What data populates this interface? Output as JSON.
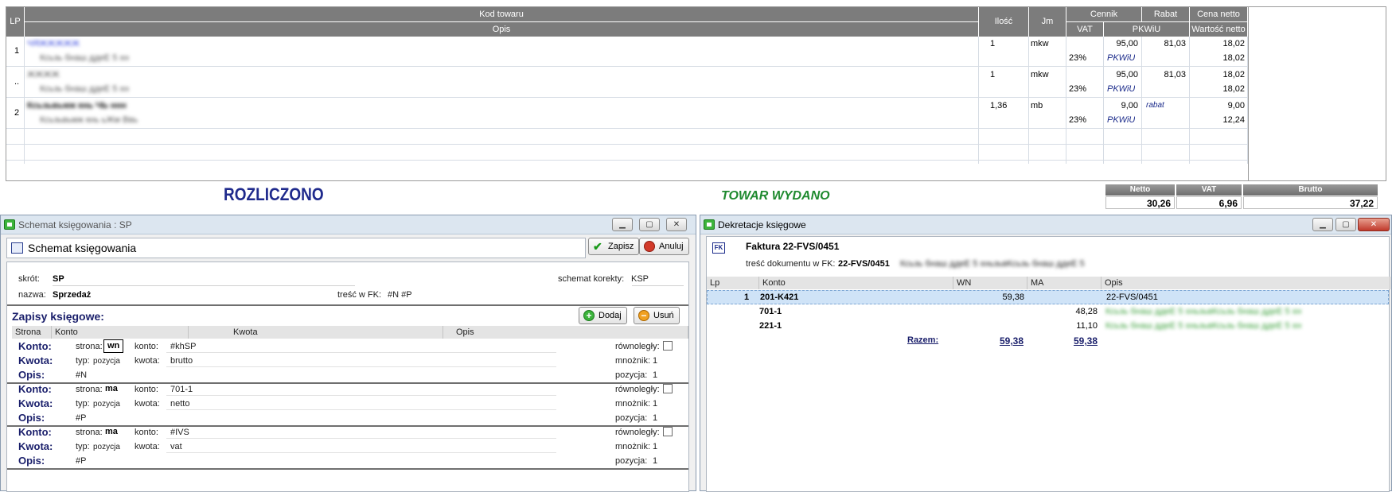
{
  "top_grid": {
    "headers": {
      "lp": "LP",
      "kod_towaru": "Kod towaru",
      "opis": "Opis",
      "ilosc": "Ilość",
      "jm": "Jm",
      "cennik": "Cennik",
      "rabat": "Rabat",
      "cena_netto": "Cena netto",
      "vat": "VAT",
      "pkwiu": "PKWiU",
      "wartosc_netto": "Wartość netto"
    },
    "rows": [
      {
        "lp": "1",
        "kod": "ЧЯЖЖЖЖЖ",
        "opis": "Ксьзь бнаш ддеЕ 5 хн",
        "ilosc": "1",
        "jm": "mkw",
        "cennik": "95,00",
        "rabat": "81,03",
        "cena_netto": "18,02",
        "vat": "23%",
        "pkwiu": "PKWiU",
        "wartosc_netto": "18,02"
      },
      {
        "lp": "..",
        "kod": "ЖЖЖЖ",
        "opis": "Ксьзь бнаш ддеЕ 5 хн",
        "ilosc": "1",
        "jm": "mkw",
        "cennik": "95,00",
        "rabat": "81,03",
        "cena_netto": "18,02",
        "vat": "23%",
        "pkwiu": "PKWiU",
        "wartosc_netto": "18,02"
      },
      {
        "lp": "2",
        "kod": "Ксьзьвьмж кнь ЧЬ ннн",
        "opis": "Ксьзьвьмж кнь ьЖм Ввь",
        "ilosc": "1,36",
        "jm": "mb",
        "cennik": "9,00",
        "rabat": "rabat",
        "cena_netto": "9,00",
        "vat": "23%",
        "pkwiu": "PKWiU",
        "wartosc_netto": "12,24"
      }
    ]
  },
  "stamps": {
    "rozliczono": "ROZLICZONO",
    "towar_wydano": "TOWAR WYDANO"
  },
  "totals": {
    "netto_label": "Netto",
    "netto": "30,26",
    "vat_label": "VAT",
    "vat": "6,96",
    "brutto_label": "Brutto",
    "brutto": "37,22"
  },
  "schemat_window": {
    "title": "Schemat księgowania : SP",
    "header": "Schemat księgowania",
    "save_label": "Zapisz",
    "cancel_label": "Anuluj",
    "skrot_label": "skrót:",
    "skrot": "SP",
    "nazwa_label": "nazwa:",
    "nazwa": "Sprzedaż",
    "korekty_label": "schemat korekty:",
    "korekty": "KSP",
    "tresc_label": "treść w FK:",
    "tresc": "#N #P",
    "zapisy_title": "Zapisy księgowe:",
    "add_label": "Dodaj",
    "remove_label": "Usuń",
    "cols": {
      "strona": "Strona",
      "konto": "Konto",
      "kwota": "Kwota",
      "opis": "Opis"
    },
    "entries": [
      {
        "konto_label": "Konto:",
        "kwota_label": "Kwota:",
        "opis_label": "Opis:",
        "strona_label": "strona:",
        "strona": "wn",
        "konto_sub_label": "konto:",
        "konto": "#khSP",
        "typ_label": "typ:",
        "typ": "pozycja",
        "kwota_sub_label": "kwota:",
        "kwota": "brutto",
        "opis": "#N",
        "rownolegly_label": "równoległy:",
        "mnoznik_label": "mnożnik:",
        "mnoznik": "1",
        "pozycja_label": "pozycja:",
        "pozycja": "1"
      },
      {
        "konto_label": "Konto:",
        "kwota_label": "Kwota:",
        "opis_label": "Opis:",
        "strona_label": "strona:",
        "strona": "ma",
        "konto_sub_label": "konto:",
        "konto": "701-1",
        "typ_label": "typ:",
        "typ": "pozycja",
        "kwota_sub_label": "kwota:",
        "kwota": "netto",
        "opis": "#P",
        "rownolegly_label": "równoległy:",
        "mnoznik_label": "mnożnik:",
        "mnoznik": "1",
        "pozycja_label": "pozycja:",
        "pozycja": "1"
      },
      {
        "konto_label": "Konto:",
        "kwota_label": "Kwota:",
        "opis_label": "Opis:",
        "strona_label": "strona:",
        "strona": "ma",
        "konto_sub_label": "konto:",
        "konto": "#IVS",
        "typ_label": "typ:",
        "typ": "pozycja",
        "kwota_sub_label": "kwota:",
        "kwota": "vat",
        "opis": "#P",
        "rownolegly_label": "równoległy:",
        "mnoznik_label": "mnożnik:",
        "mnoznik": "1",
        "pozycja_label": "pozycja:",
        "pozycja": "1"
      }
    ]
  },
  "dekretacje_window": {
    "title": "Dekretacje księgowe",
    "fk_badge": "FK",
    "faktura": "Faktura 22-FVS/0451",
    "tresc_label": "treść dokumentu w FK:",
    "tresc": "22-FVS/0451",
    "tresc_blurred": "Ксьзь бнаш ддеЕ 5 хньзьвКсьзь бнаш ддеЕ 5",
    "cols": {
      "lp": "Lp",
      "konto": "Konto",
      "wn": "WN",
      "ma": "MA",
      "opis": "Opis"
    },
    "rows": [
      {
        "lp": "1",
        "konto": "201-K421",
        "wn": "59,38",
        "ma": "",
        "opis": "22-FVS/0451"
      },
      {
        "lp": "",
        "konto": "701-1",
        "wn": "",
        "ma": "48,28",
        "opis": "Ксьзь бнаш ддеЕ 5 хньзьвКсьзь бнаш ддеЕ 5 хн"
      },
      {
        "lp": "",
        "konto": "221-1",
        "wn": "",
        "ma": "11,10",
        "opis": "Ксьзь бнаш ддеЕ 5 хньзьвКсьзь бнаш ддеЕ 5 хн"
      }
    ],
    "razem_label": "Razem:",
    "razem_wn": "59,38",
    "razem_ma": "59,38"
  },
  "colors": {
    "stamp_blue": "#1f2a8c",
    "stamp_green": "#1f8a2f",
    "selected_row": "#cfe3f7",
    "header_gray": "#7c7c7c"
  }
}
